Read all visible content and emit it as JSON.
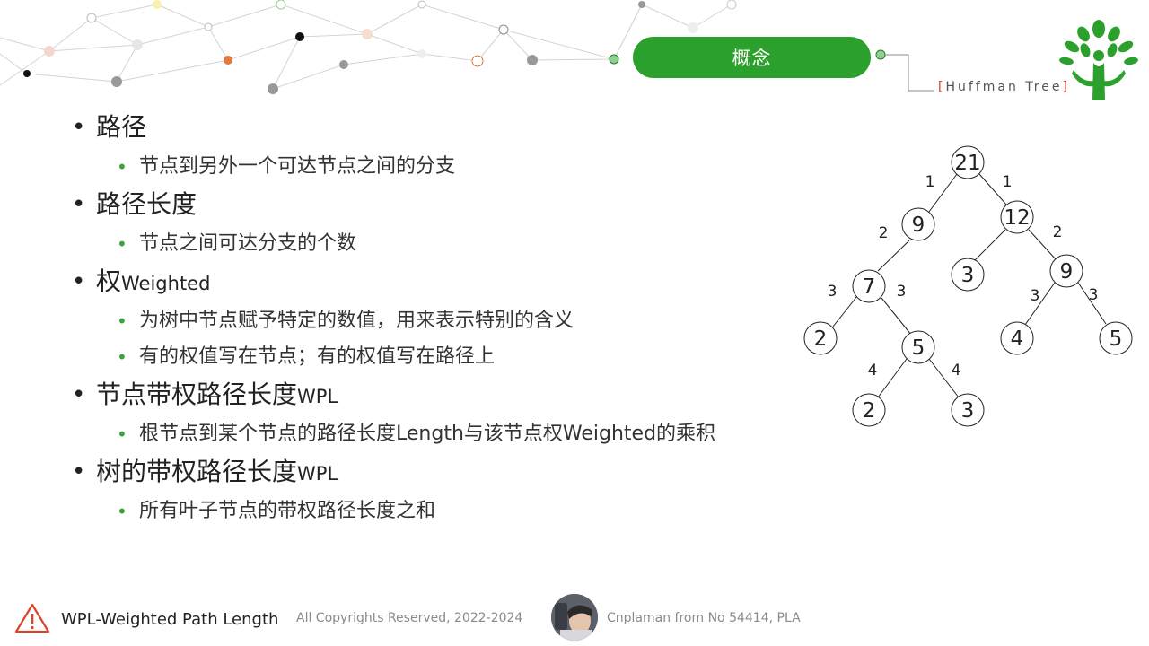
{
  "slide": {
    "title": "概念",
    "subtitle_open": "[",
    "subtitle_text": "Huffman Tree",
    "subtitle_close": "]"
  },
  "bullets": [
    {
      "main": "路径",
      "main_suffix": "",
      "subs": [
        "节点到另外一个可达节点之间的分支"
      ]
    },
    {
      "main": "路径长度",
      "main_suffix": "",
      "subs": [
        "节点之间可达分支的个数"
      ]
    },
    {
      "main": "权",
      "main_suffix": "Weighted",
      "subs": [
        "为树中节点赋予特定的数值，用来表示特别的含义",
        "有的权值写在节点；有的权值写在路径上"
      ]
    },
    {
      "main": "节点带权路径长度",
      "main_suffix": "WPL",
      "subs": [
        "根节点到某个节点的路径长度Length与该节点权Weighted的乘积"
      ]
    },
    {
      "main": "树的带权路径长度",
      "main_suffix": "WPL",
      "subs": [
        "所有叶子节点的带权路径长度之和"
      ]
    }
  ],
  "tree": {
    "nodes": [
      "21",
      "9",
      "12",
      "7",
      "3",
      "9",
      "2",
      "5",
      "4",
      "5",
      "2",
      "3"
    ],
    "edge_labels": [
      "1",
      "1",
      "2",
      "2",
      "3",
      "3",
      "3",
      "3",
      "4",
      "4"
    ]
  },
  "footer": {
    "label": "WPL-Weighted Path Length",
    "copyright": "All Copyrights Reserved, 2022-2024",
    "author": "Cnplaman from No 54414, PLA"
  },
  "colors": {
    "accent": "#2ca02c",
    "bracket": "#dd3333",
    "warning": "#d9442b"
  },
  "icons": [
    "warning-icon",
    "tree-logo-icon",
    "avatar"
  ]
}
